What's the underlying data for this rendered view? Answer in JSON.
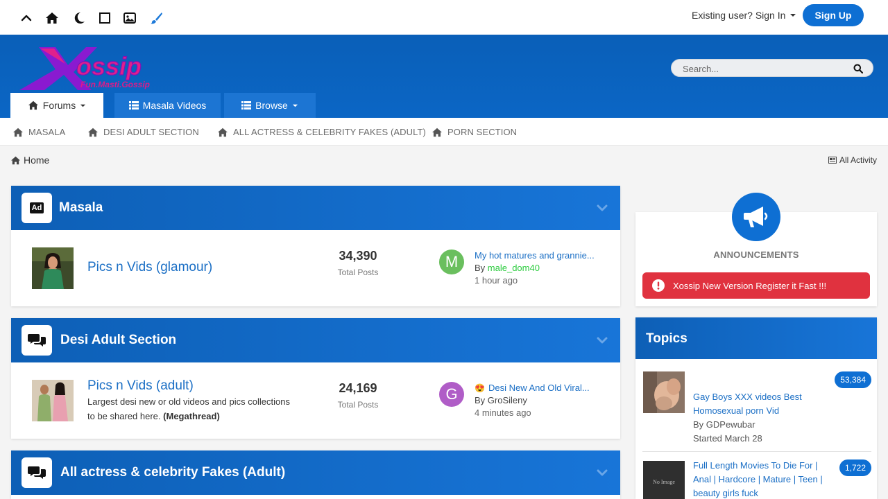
{
  "topbar": {
    "icons": [
      "chevron-up-icon",
      "home-icon",
      "moon-icon",
      "square-icon",
      "image-icon",
      "brush-icon"
    ],
    "signin_label": "Existing user? Sign In",
    "signup_label": "Sign Up"
  },
  "header": {
    "logo_text": "Xossip",
    "logo_tagline": "Fun.Masti.Gossip",
    "search_placeholder": "Search...",
    "tabs": [
      {
        "label": "Forums"
      },
      {
        "label": "Masala Videos"
      },
      {
        "label": "Browse"
      }
    ]
  },
  "subnav": {
    "items": [
      {
        "label": "MASALA"
      },
      {
        "label": "DESI ADULT SECTION"
      },
      {
        "label": "ALL ACTRESS & CELEBRITY FAKES (ADULT)"
      },
      {
        "label": "PORN SECTION"
      }
    ]
  },
  "breadcrumb": {
    "home": "Home",
    "all_activity": "All Activity"
  },
  "categories": [
    {
      "title": "Masala",
      "icon_text": "Ad",
      "forum": {
        "title": "Pics n Vids (glamour)",
        "posts": "34,390",
        "posts_label": "Total Posts",
        "avatar_letter": "M",
        "avatar_color": "#6abf5e",
        "last_title": "My hot matures and grannie...",
        "last_by_prefix": "By",
        "last_user": "male_dom40",
        "last_time": "1 hour ago"
      }
    },
    {
      "title": "Desi Adult Section",
      "forum": {
        "title": "Pics n Vids (adult)",
        "desc": "Largest desi new or old videos and pics collections to be shared here.",
        "desc_bold": "(Megathread)",
        "posts": "24,169",
        "posts_label": "Total Posts",
        "avatar_letter": "G",
        "avatar_color": "#b05dc7",
        "last_emoji": "😍",
        "last_title": "Desi New And Old Viral...",
        "last_by": "By GroSileny",
        "last_time": "4 minutes ago"
      }
    },
    {
      "title": "All actress & celebrity Fakes (Adult)"
    }
  ],
  "announcements": {
    "label": "ANNOUNCEMENTS",
    "alert": "Xossip New Version Register it Fast !!!"
  },
  "topics": {
    "title": "Topics",
    "items": [
      {
        "title": "Gay Boys XXX videos Best Homosexual porn Vid",
        "by": "By GDPewubar",
        "started": "Started March 28",
        "count": "53,384"
      },
      {
        "title": "Full Length Movies To Die For | Anal | Hardcore | Mature | Teen | beauty girls fuck",
        "thumb_text": "No Image",
        "count": "1,722"
      }
    ]
  },
  "colors": {
    "brand_blue": "#0e6fd3",
    "link_blue": "#1b6fc5",
    "alert_red": "#e0323f",
    "user_green": "#2ecc40"
  }
}
